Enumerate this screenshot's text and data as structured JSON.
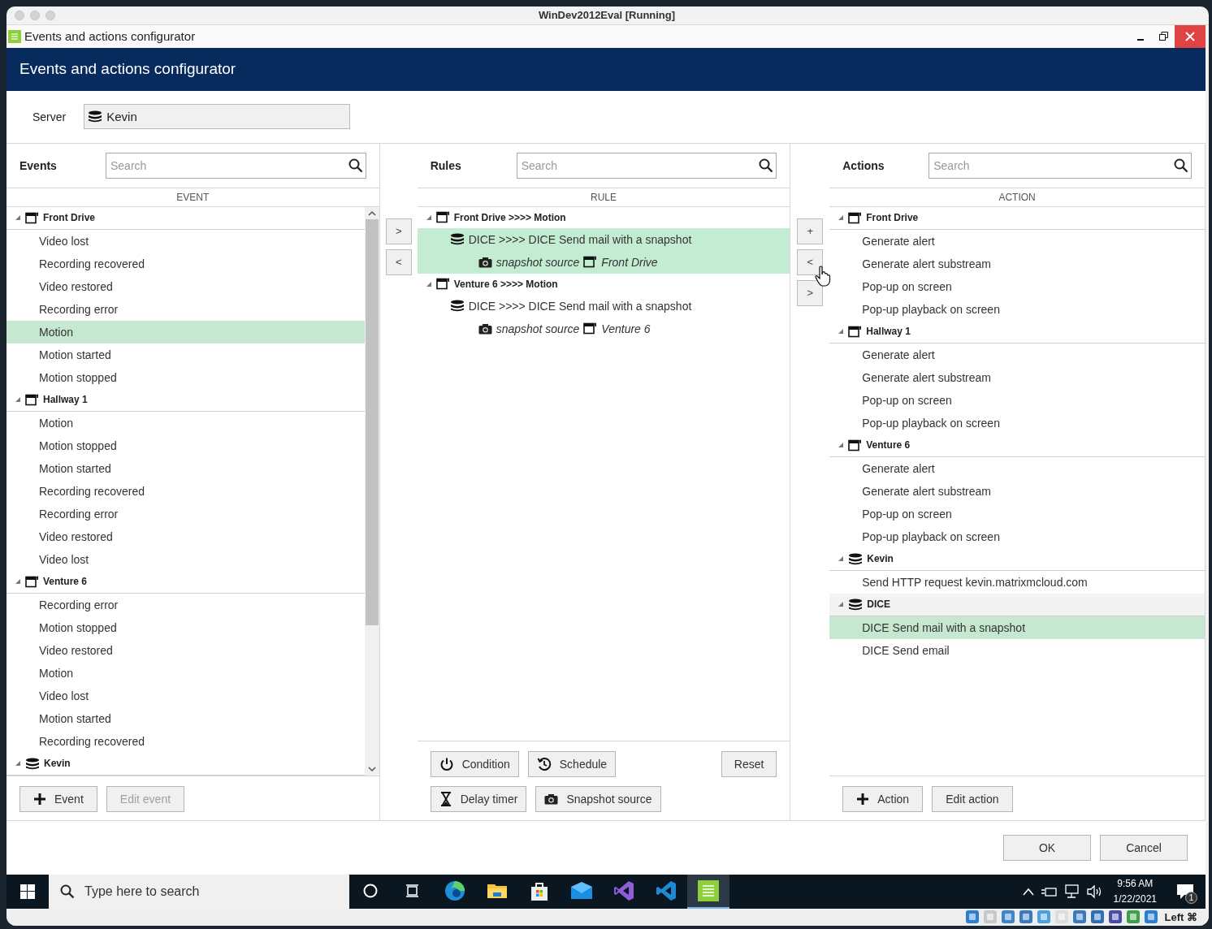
{
  "host_window": {
    "title": "WinDev2012Eval [Running]"
  },
  "window": {
    "title": "Events and actions configurator"
  },
  "header": {
    "title": "Events and actions configurator"
  },
  "server": {
    "label": "Server",
    "value": "Kevin"
  },
  "events": {
    "title": "Events",
    "search": {
      "placeholder": "Search"
    },
    "column": "EVENT",
    "groups": [
      {
        "name": "Front Drive",
        "kind": "camera",
        "expanded": true,
        "items": [
          {
            "label": "Video lost",
            "selected": false
          },
          {
            "label": "Recording recovered",
            "selected": false
          },
          {
            "label": "Video restored",
            "selected": false
          },
          {
            "label": "Recording error",
            "selected": false
          },
          {
            "label": "Motion",
            "selected": true
          },
          {
            "label": "Motion started",
            "selected": false
          },
          {
            "label": "Motion stopped",
            "selected": false
          }
        ]
      },
      {
        "name": "Hallway 1",
        "kind": "camera",
        "expanded": true,
        "items": [
          {
            "label": "Motion",
            "selected": false
          },
          {
            "label": "Motion stopped",
            "selected": false
          },
          {
            "label": "Motion started",
            "selected": false
          },
          {
            "label": "Recording recovered",
            "selected": false
          },
          {
            "label": "Recording error",
            "selected": false
          },
          {
            "label": "Video restored",
            "selected": false
          },
          {
            "label": "Video lost",
            "selected": false
          }
        ]
      },
      {
        "name": "Venture 6",
        "kind": "camera",
        "expanded": true,
        "items": [
          {
            "label": "Recording error",
            "selected": false
          },
          {
            "label": "Motion stopped",
            "selected": false
          },
          {
            "label": "Video restored",
            "selected": false
          },
          {
            "label": "Motion",
            "selected": false
          },
          {
            "label": "Video lost",
            "selected": false
          },
          {
            "label": "Motion started",
            "selected": false
          },
          {
            "label": "Recording recovered",
            "selected": false
          }
        ]
      },
      {
        "name": "Kevin",
        "kind": "server",
        "expanded": true,
        "selected": false
      }
    ],
    "buttons": [
      {
        "label": "Event",
        "kind": "add",
        "disabled": false
      },
      {
        "label": "Edit event",
        "kind": "plain",
        "disabled": true
      }
    ]
  },
  "transfer_left": [
    ">",
    "<"
  ],
  "rules": {
    "title": "Rules",
    "search": {
      "placeholder": "Search"
    },
    "column": "RULE",
    "groups": [
      {
        "name": "Front Drive >>>> Motion",
        "kind": "camera",
        "expanded": true,
        "rules": [
          {
            "action": "DICE >>>> DICE Send mail with a snapshot",
            "selected": true,
            "source_label": "snapshot source",
            "source_camera": "Front Drive"
          }
        ]
      },
      {
        "name": "Venture 6 >>>> Motion",
        "kind": "camera",
        "expanded": true,
        "rules": [
          {
            "action": "DICE >>>> DICE Send mail with a snapshot",
            "selected": false,
            "source_label": "snapshot source",
            "source_camera": "Venture 6"
          }
        ]
      }
    ],
    "buttons": [
      {
        "label": "Condition",
        "kind": "power"
      },
      {
        "label": "Schedule",
        "kind": "schedule"
      },
      {
        "label": "Reset",
        "kind": "plain"
      },
      {
        "label": "Delay timer",
        "kind": "hourglass"
      },
      {
        "label": "Snapshot source",
        "kind": "camera"
      }
    ]
  },
  "transfer_right": [
    "+",
    "<",
    ">"
  ],
  "actions": {
    "title": "Actions",
    "search": {
      "placeholder": "Search"
    },
    "column": "ACTION",
    "groups": [
      {
        "name": "Front Drive",
        "kind": "camera",
        "expanded": true,
        "items": [
          {
            "label": "Generate alert",
            "selected": false
          },
          {
            "label": "Generate alert substream",
            "selected": false
          },
          {
            "label": "Pop-up on screen",
            "selected": false
          },
          {
            "label": "Pop-up playback on screen",
            "selected": false
          }
        ]
      },
      {
        "name": "Hallway 1",
        "kind": "camera",
        "expanded": true,
        "items": [
          {
            "label": "Generate alert",
            "selected": false
          },
          {
            "label": "Generate alert substream",
            "selected": false
          },
          {
            "label": "Pop-up on screen",
            "selected": false
          },
          {
            "label": "Pop-up playback on screen",
            "selected": false
          }
        ]
      },
      {
        "name": "Venture 6",
        "kind": "camera",
        "expanded": true,
        "items": [
          {
            "label": "Generate alert",
            "selected": false
          },
          {
            "label": "Generate alert substream",
            "selected": false
          },
          {
            "label": "Pop-up on screen",
            "selected": false
          },
          {
            "label": "Pop-up playback on screen",
            "selected": false
          }
        ]
      },
      {
        "name": "Kevin",
        "kind": "server",
        "expanded": true,
        "items": [
          {
            "label": "Send HTTP request kevin.matrixmcloud.com",
            "selected": false
          }
        ]
      },
      {
        "name": "DICE",
        "kind": "server",
        "expanded": true,
        "selected": true,
        "items": [
          {
            "label": "DICE Send mail with a snapshot",
            "selected": true
          },
          {
            "label": "DICE Send email",
            "selected": false
          }
        ]
      }
    ],
    "buttons": [
      {
        "label": "Action",
        "kind": "add",
        "disabled": false
      },
      {
        "label": "Edit action",
        "kind": "plain",
        "disabled": false
      }
    ]
  },
  "dialog_buttons": [
    "OK",
    "Cancel"
  ],
  "taskbar": {
    "search": {
      "placeholder": "Type here to search"
    },
    "apps": [
      {
        "kind": "cortana",
        "selected": false
      },
      {
        "kind": "taskview",
        "selected": false
      },
      {
        "kind": "edge",
        "selected": false
      },
      {
        "kind": "folder",
        "selected": false
      },
      {
        "kind": "store",
        "selected": false
      },
      {
        "kind": "mail",
        "selected": false
      },
      {
        "kind": "vs",
        "selected": false
      },
      {
        "kind": "vscode",
        "selected": false
      },
      {
        "kind": "configurator",
        "selected": true
      }
    ],
    "time": "9:56 AM",
    "date": "1/22/2021",
    "notifications": "1"
  },
  "vm_status": {
    "host_key": "Left ⌘"
  }
}
